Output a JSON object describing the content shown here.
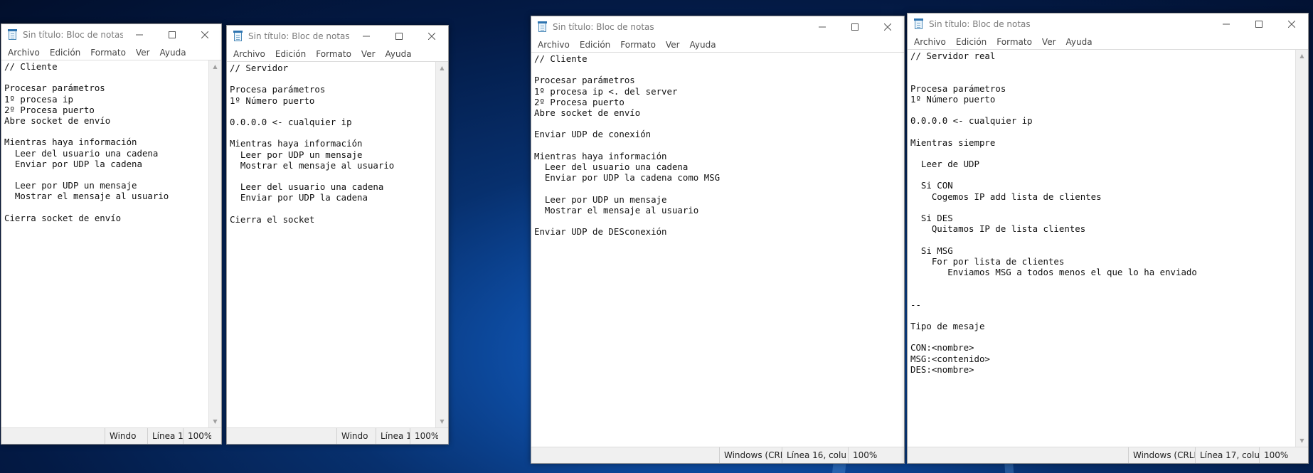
{
  "windows": [
    {
      "title": "Sin título: Bloc de notas",
      "menu": [
        "Archivo",
        "Edición",
        "Formato",
        "Ver",
        "Ayuda"
      ],
      "content": "// Cliente\n\nProcesar parámetros\n1º procesa ip\n2º Procesa puerto\nAbre socket de envío\n\nMientras haya información\n  Leer del usuario una cadena\n  Enviar por UDP la cadena\n\n  Leer por UDP un mensaje\n  Mostrar el mensaje al usuario\n\nCierra socket de envío",
      "status": {
        "encoding": "Windo",
        "position": "Línea 1",
        "zoom": "100%"
      }
    },
    {
      "title": "Sin título: Bloc de notas",
      "menu": [
        "Archivo",
        "Edición",
        "Formato",
        "Ver",
        "Ayuda"
      ],
      "content": "// Servidor\n\nProcesa parámetros\n1º Número puerto\n\n0.0.0.0 <- cualquier ip\n\nMientras haya información\n  Leer por UDP un mensaje\n  Mostrar el mensaje al usuario\n\n  Leer del usuario una cadena\n  Enviar por UDP la cadena\n\nCierra el socket",
      "status": {
        "encoding": "Windo",
        "position": "Línea 1",
        "zoom": "100%"
      }
    },
    {
      "title": "Sin título: Bloc de notas",
      "menu": [
        "Archivo",
        "Edición",
        "Formato",
        "Ver",
        "Ayuda"
      ],
      "content": "// Cliente\n\nProcesar parámetros\n1º procesa ip <. del server\n2º Procesa puerto\nAbre socket de envío\n\nEnviar UDP de conexión\n\nMientras haya información\n  Leer del usuario una cadena\n  Enviar por UDP la cadena como MSG\n\n  Leer por UDP un mensaje\n  Mostrar el mensaje al usuario\n\nEnviar UDP de DESconexión",
      "status": {
        "encoding": "Windows (CRI",
        "position": "Línea 16, colu",
        "zoom": "100%"
      }
    },
    {
      "title": "Sin título: Bloc de notas",
      "menu": [
        "Archivo",
        "Edición",
        "Formato",
        "Ver",
        "Ayuda"
      ],
      "content": "// Servidor real\n\n\nProcesa parámetros\n1º Número puerto\n\n0.0.0.0 <- cualquier ip\n\nMientras siempre\n\n  Leer de UDP\n\n  Si CON\n    Cogemos IP add lista de clientes\n\n  Si DES\n    Quitamos IP de lista clientes\n\n  Si MSG\n    For por lista de clientes\n       Enviamos MSG a todos menos el que lo ha enviado\n\n\n--\n\nTipo de mesaje\n\nCON:<nombre>\nMSG:<contenido>\nDES:<nombre>",
      "status": {
        "encoding": "Windows (CRLI",
        "position": "Línea 17, colum",
        "zoom": "100%"
      }
    }
  ]
}
